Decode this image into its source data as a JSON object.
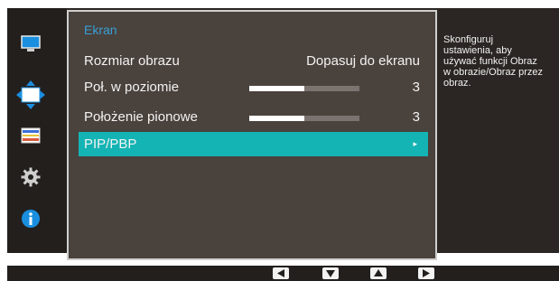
{
  "menu": {
    "title": "Ekran",
    "items": [
      {
        "label": "Rozmiar obrazu",
        "value": "Dopasuj do ekranu"
      },
      {
        "label": "Poł. w poziomie",
        "value": "3",
        "level": 0.5
      },
      {
        "label": "Położenie pionowe",
        "value": "3",
        "level": 0.5
      },
      {
        "label": "PIP/PBP",
        "arrow": "▸"
      }
    ],
    "selected_index": 3
  },
  "help_text": "Skonfiguruj\nustawienia, aby\nużywać funkcji Obraz\nw obrazie/Obraz przez\nobraz.",
  "sidebar": {
    "icons": [
      "monitor-icon",
      "position-arrows-icon",
      "color-bars-icon",
      "gear-icon",
      "info-icon"
    ],
    "active_index": 1
  },
  "nav": {
    "buttons": [
      "left-arrow-icon",
      "down-arrow-icon",
      "up-arrow-icon",
      "right-arrow-icon"
    ]
  },
  "colors": {
    "accent": "#15b4b4",
    "title": "#38a0d8",
    "panel": "#4a423d",
    "background": "#2b2623"
  }
}
